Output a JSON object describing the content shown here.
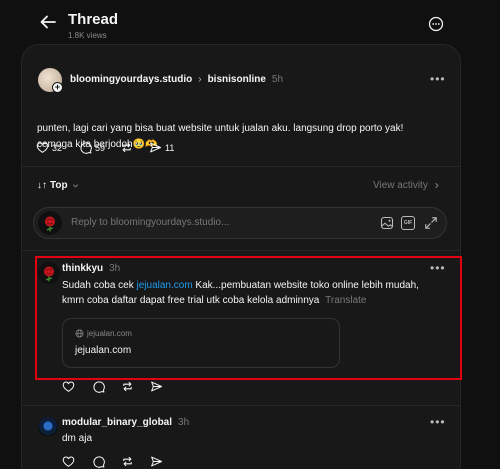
{
  "header": {
    "title": "Thread",
    "views": "1.8K views"
  },
  "original_post": {
    "username": "bloomingyourdays.studio",
    "separator": "›",
    "tag": "bisnisonline",
    "time": "5h",
    "text_line1": "punten, lagi cari yang bisa buat website untuk jualan aku. langsung drop porto yak!",
    "text_line2": "cemoga kita berjodoh",
    "text_emoji": "🥹🫶",
    "likes": "32",
    "comments": "59",
    "shares": "11"
  },
  "sort": {
    "label": "Top",
    "view_activity": "View activity"
  },
  "reply_box": {
    "placeholder": "Reply to bloomingyourdays.studio...",
    "gif_label": "GIF"
  },
  "replies": [
    {
      "username": "thinkkyu",
      "time": "3h",
      "text_before_link": "Sudah coba cek ",
      "link": "jejualan.com",
      "text_after_link": " Kak...pembuatan website toko online lebih mudah,",
      "text_line2": "kmrn coba daftar dapat free trial utk coba kelola adminnya",
      "translate": "Translate",
      "link_preview_domain": "jejualan.com",
      "link_preview_title": "jejualan.com"
    },
    {
      "username": "modular_binary_global",
      "time": "3h",
      "text": "dm aja"
    }
  ],
  "colors": {
    "background": "#101010",
    "card": "#181818",
    "link": "#1d9bf0",
    "highlight": "#e3000f"
  }
}
